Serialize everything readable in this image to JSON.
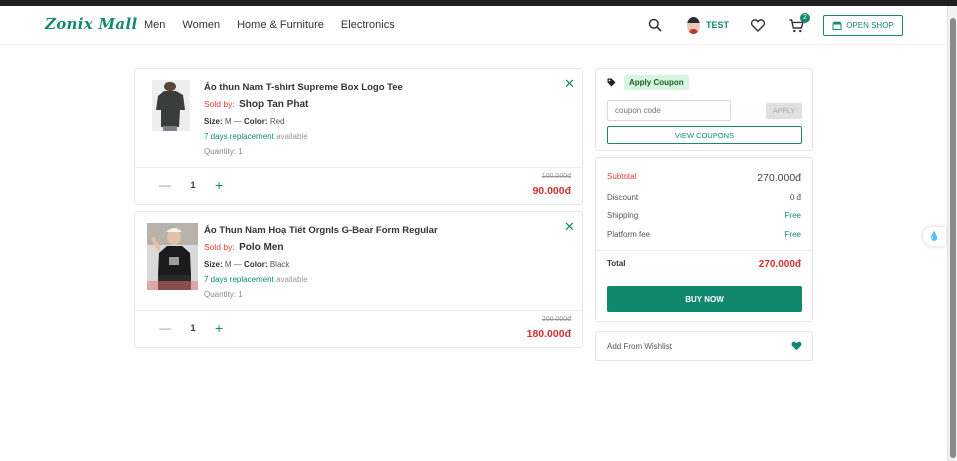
{
  "header": {
    "logo": "Zonix Mall",
    "nav": [
      "Men",
      "Women",
      "Home & Furniture",
      "Electronics"
    ],
    "username": "TEST",
    "cart_count": "2",
    "open_shop_label": "OPEN SHOP",
    "accent_color": "#15896f"
  },
  "cart_items": [
    {
      "name": "Áo thun Nam T-shirt Supreme Box Logo Tee",
      "sold_by_label": "Sold by:",
      "shop": "Shop Tan Phat",
      "size_label": "Size:",
      "size": "M",
      "color_label": "Color:",
      "color": "Red",
      "replacement_days": "7 days replacement",
      "replacement_status": "available",
      "quantity_text": "Quantity: 1",
      "quantity_value": "1",
      "old_price": "100.000đ",
      "new_price": "90.000đ"
    },
    {
      "name": "Áo Thun Nam Hoạ Tiết Orgnls G-Bear Form Regular",
      "sold_by_label": "Sold by:",
      "shop": "Polo Men",
      "size_label": "Size:",
      "size": "M",
      "color_label": "Color:",
      "color": "Black",
      "replacement_days": "7 days replacement",
      "replacement_status": "available",
      "quantity_text": "Quantity: 1",
      "quantity_value": "1",
      "old_price": "200.000đ",
      "new_price": "180.000đ"
    }
  ],
  "coupon": {
    "badge": "Apply Coupon",
    "placeholder": "coupon code",
    "apply_label": "APPLY",
    "view_label": "VIEW COUPONS"
  },
  "summary": {
    "subtotal_label": "Subtotal",
    "subtotal_value": "270.000đ",
    "discount_label": "Discount",
    "discount_value": "0 đ",
    "shipping_label": "Shipping",
    "shipping_value": "Free",
    "fee_label": "Platform fee",
    "fee_value": "Free",
    "total_label": "Total",
    "total_value": "270.000đ",
    "buy_label": "BUY NOW"
  },
  "wishlist": {
    "label": "Add From Wishlist"
  }
}
